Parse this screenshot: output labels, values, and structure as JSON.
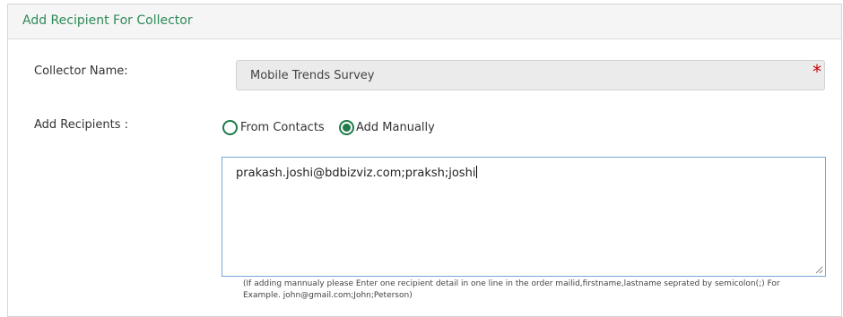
{
  "panel": {
    "title": "Add Recipient For Collector"
  },
  "collector": {
    "label": "Collector Name:",
    "value": "Mobile Trends Survey",
    "required_marker": "*"
  },
  "recipients": {
    "label": "Add Recipients :",
    "options": [
      {
        "label": "From Contacts",
        "selected": false
      },
      {
        "label": "Add Manually",
        "selected": true
      }
    ],
    "textarea_value": "prakash.joshi@bdbizviz.com;praksh;joshi",
    "help_text": "(If adding mannualy please Enter one recipient detail in one line in the order mailid,firstname,lastname seprated by semicolon(;) For Example. john@gmail.com;John;Peterson)"
  },
  "colors": {
    "accent_green": "#1f7a4a",
    "title_green": "#2e8b57",
    "required_red": "#cc0000",
    "focus_border": "#7aa7d9"
  }
}
